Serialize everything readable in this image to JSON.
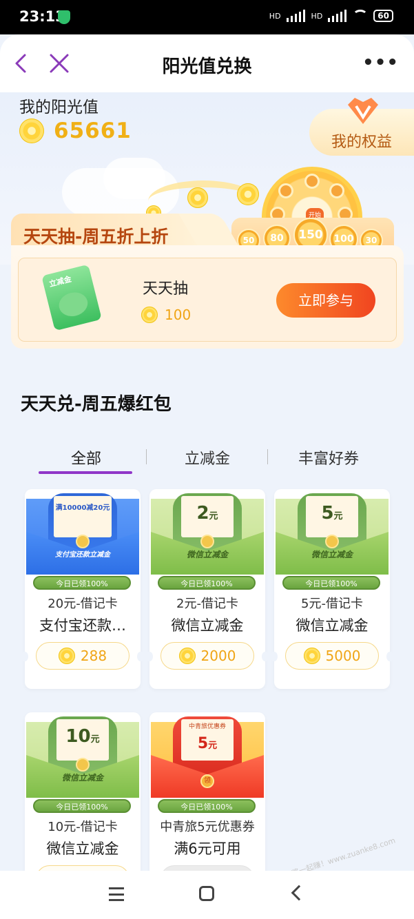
{
  "status": {
    "time": "23:13",
    "hd1": "HD",
    "hd2": "HD",
    "battery": "60"
  },
  "header": {
    "title": "阳光值兑换"
  },
  "sunshine": {
    "label": "我的阳光值",
    "value": "65661",
    "rights_label": "我的权益"
  },
  "lottery": {
    "section_title": "天天抽-周五折上折",
    "item_name": "天天抽",
    "item_price": "100",
    "join_label": "立即参与",
    "envelope_tag": "立减金",
    "wheel_center": "开始",
    "chips": [
      "50",
      "80",
      "150",
      "100",
      "30"
    ]
  },
  "exchange": {
    "section_title": "天天兑-周五爆红包",
    "tabs": [
      "全部",
      "立减金",
      "丰富好券"
    ],
    "active_tab": 0
  },
  "cards": [
    {
      "art": "blue",
      "note_big": "满10000减20元",
      "note_small": "",
      "caption": "支付宝还款立减金",
      "pill": "今日已领100%",
      "line1": "20元-借记卡",
      "line2": "支付宝还款…",
      "price": "288"
    },
    {
      "art": "green",
      "note_big": "2",
      "note_unit": "元",
      "caption": "微信立减金",
      "pill": "今日已领100%",
      "line1": "2元-借记卡",
      "line2": "微信立减金",
      "price": "2000"
    },
    {
      "art": "green",
      "note_big": "5",
      "note_unit": "元",
      "caption": "微信立减金",
      "pill": "今日已领100%",
      "line1": "5元-借记卡",
      "line2": "微信立减金",
      "price": "5000"
    },
    {
      "art": "green",
      "note_big": "10",
      "note_unit": "元",
      "caption": "微信立减金",
      "pill": "今日已领100%",
      "line1": "10元-借记卡",
      "line2": "微信立减金",
      "price": ""
    },
    {
      "art": "red",
      "note_small": "中青旅优惠券",
      "note_big": "5",
      "note_unit": "元",
      "seal": "领",
      "pill": "今日已领100%",
      "line1": "中青旅5元优惠券",
      "line2": "满6元可用",
      "price": ""
    }
  ],
  "watermark": "赚客吧，有奖一起赚！www.zuanke8.com",
  "colors": {
    "accent_purple": "#9036c8",
    "coin_gold": "#f0b016",
    "button_orange": "#f04520",
    "pill_green": "#6aa540"
  }
}
